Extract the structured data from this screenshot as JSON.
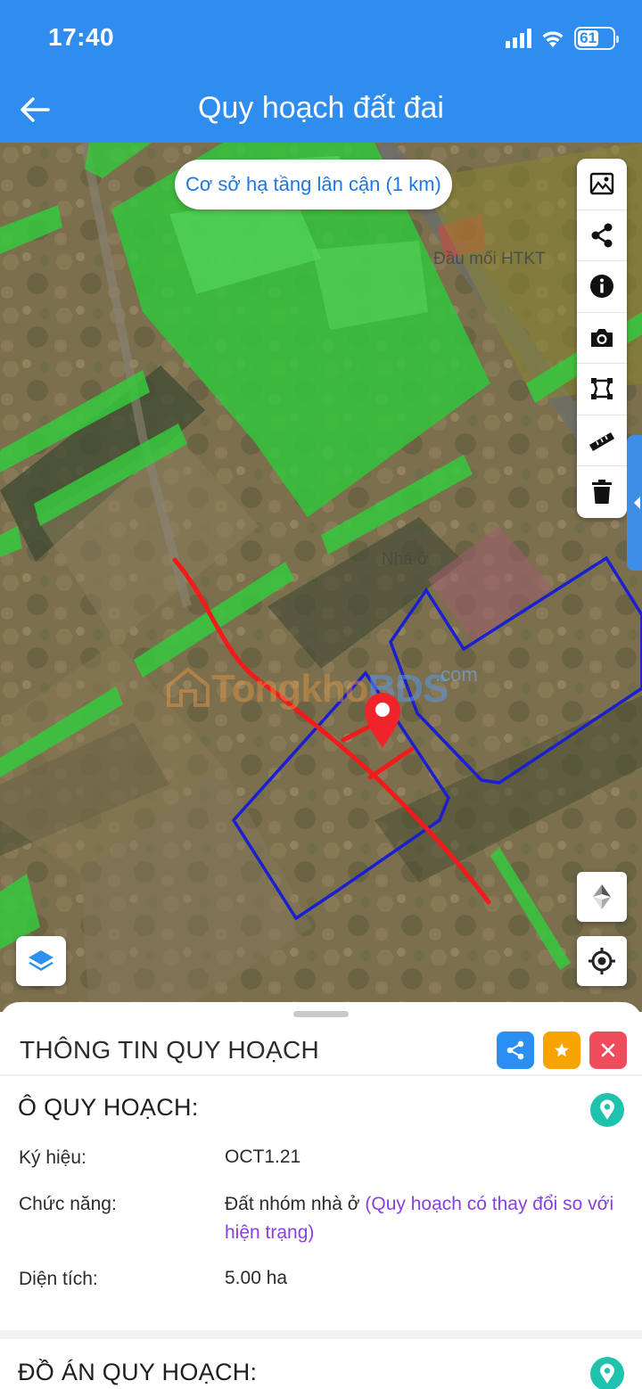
{
  "status_bar": {
    "time": "17:40",
    "battery": "61"
  },
  "header": {
    "title": "Quy hoạch đất đai"
  },
  "map": {
    "nearby_button": "Cơ sở hạ tầng lân cận (1 km)",
    "labels": {
      "utility": "Đầu mối HTKT",
      "housing": "Nhà ở"
    },
    "watermark": {
      "part1": "Tongkho",
      "part2": "BDS",
      "suffix": ".com"
    },
    "tools": [
      "image-icon",
      "share-icon",
      "info-icon",
      "camera-icon",
      "polygon-icon",
      "ruler-icon",
      "trash-icon"
    ]
  },
  "sheet": {
    "title": "THÔNG TIN QUY HOẠCH",
    "section1": {
      "title": "Ô QUY HOẠCH:",
      "rows": [
        {
          "label": "Ký hiệu:",
          "value": "OCT1.21"
        },
        {
          "label": "Chức năng:",
          "value": "Đất nhóm nhà ở",
          "note": "(Quy hoạch có thay đổi so với hiện trạng)"
        },
        {
          "label": "Diện tích:",
          "value": "5.00 ha"
        }
      ]
    },
    "section2": {
      "title": "ĐỒ ÁN QUY HOẠCH:"
    }
  },
  "colors": {
    "header": "#2f8df0",
    "share": "#2a8ff2",
    "star": "#f7a300",
    "close": "#ef4d5b",
    "location": "#1fc2ac",
    "note": "#8a3fe0"
  }
}
